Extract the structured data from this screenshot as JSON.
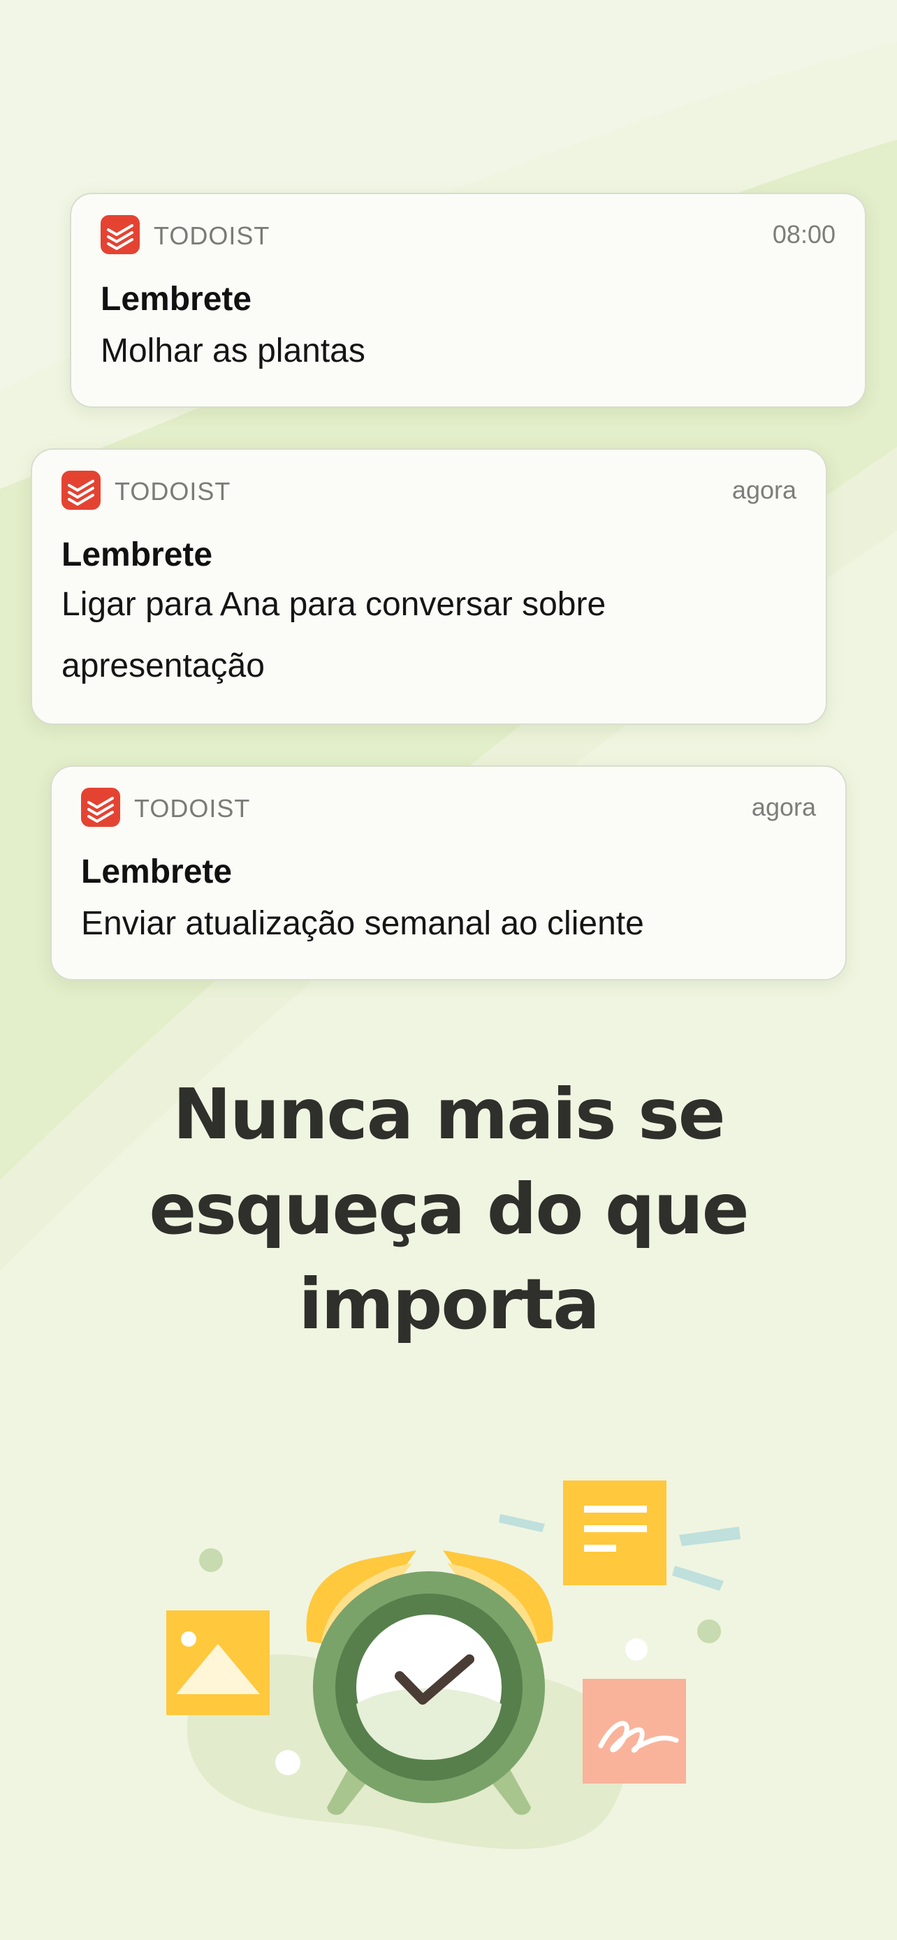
{
  "notifications": [
    {
      "app_name": "TODOIST",
      "time": "08:00",
      "title": "Lembrete",
      "body": "Molhar as plantas"
    },
    {
      "app_name": "TODOIST",
      "time": "agora",
      "title": "Lembrete",
      "body": "Ligar para Ana para conversar sobre apresentação"
    },
    {
      "app_name": "TODOIST",
      "time": "agora",
      "title": "Lembrete",
      "body": "Enviar atualização semanal ao cliente"
    }
  ],
  "headline": {
    "line1": "Nunca mais se",
    "line2": "esqueça do que",
    "line3": "importa"
  },
  "colors": {
    "background": "#eef4dc",
    "brand_red": "#e44332",
    "alarm_green": "#5e8a52",
    "note_yellow": "#ffc83d",
    "note_salmon": "#f9b39a"
  },
  "icons": {
    "app_icon": "todoist-logo-icon",
    "illustration": "alarm-clock-icon"
  }
}
